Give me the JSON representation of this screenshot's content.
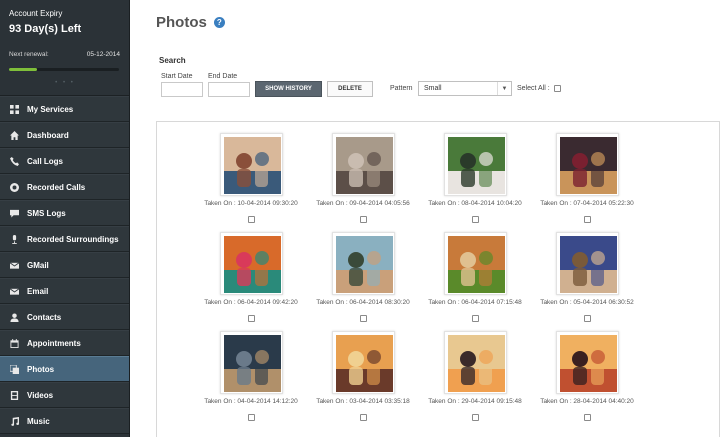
{
  "account": {
    "expiry_label": "Account Expiry",
    "days_left": "93 Day(s) Left",
    "renewal_label": "Next renewal:",
    "renewal_date": "05-12-2014",
    "progress_fraction": 0.25
  },
  "sidebar": {
    "items": [
      {
        "label": "My Services",
        "icon": "grid-icon"
      },
      {
        "label": "Dashboard",
        "icon": "dashboard-icon"
      },
      {
        "label": "Call Logs",
        "icon": "phone-icon"
      },
      {
        "label": "Recorded Calls",
        "icon": "record-icon"
      },
      {
        "label": "SMS Logs",
        "icon": "chat-icon"
      },
      {
        "label": "Recorded Surroundings",
        "icon": "microphone-icon"
      },
      {
        "label": "GMail",
        "icon": "mail-icon"
      },
      {
        "label": "Email",
        "icon": "mail-icon"
      },
      {
        "label": "Contacts",
        "icon": "person-icon"
      },
      {
        "label": "Appointments",
        "icon": "calendar-icon"
      },
      {
        "label": "Photos",
        "icon": "photos-icon",
        "active": true
      },
      {
        "label": "Videos",
        "icon": "film-icon"
      },
      {
        "label": "Music",
        "icon": "music-icon"
      }
    ]
  },
  "page": {
    "title": "Photos",
    "help_glyph": "?"
  },
  "search": {
    "heading": "Search",
    "start_date_label": "Start Date",
    "start_date_value": "",
    "end_date_label": "End Date",
    "end_date_value": "",
    "show_history_label": "SHOW HISTORY",
    "delete_label": "DELETE",
    "pattern_label": "Pattern",
    "pattern_value": "Small",
    "select_all_label": "Select All :"
  },
  "photos": [
    {
      "caption": "Taken On : 10-04-2014 09:30:20",
      "palette": [
        "#d9b89a",
        "#3a5a7a",
        "#8a4f3a"
      ]
    },
    {
      "caption": "Taken On : 09-04-2014 04:05:56",
      "palette": [
        "#a89a8a",
        "#5c4f48",
        "#c9bcb0"
      ]
    },
    {
      "caption": "Taken On : 08-04-2014 10:04:20",
      "palette": [
        "#4a7a3a",
        "#e8e4e0",
        "#2a3a2a"
      ]
    },
    {
      "caption": "Taken On : 07-04-2014 05:22:30",
      "palette": [
        "#3a2a30",
        "#c9945a",
        "#7a2030"
      ]
    },
    {
      "caption": "Taken On : 06-04-2014 09:42:20",
      "palette": [
        "#d86a2a",
        "#2a8a7a",
        "#d93a5a"
      ]
    },
    {
      "caption": "Taken On : 06-04-2014 08:30:20",
      "palette": [
        "#8ab0c0",
        "#c9a07a",
        "#3a4a3a"
      ]
    },
    {
      "caption": "Taken On : 06-04-2014 07:15:48",
      "palette": [
        "#c87a3a",
        "#5a8a2a",
        "#e0c090"
      ]
    },
    {
      "caption": "Taken On : 05-04-2014 06:30:52",
      "palette": [
        "#3a4a8a",
        "#d0b090",
        "#7a5a3a"
      ]
    },
    {
      "caption": "Taken On : 04-04-2014 14:12:20",
      "palette": [
        "#2a3a4a",
        "#b0906a",
        "#6a7a8a"
      ]
    },
    {
      "caption": "Taken On : 03-04-2014 03:35:18",
      "palette": [
        "#e8a050",
        "#6a3a2a",
        "#f0d090"
      ]
    },
    {
      "caption": "Taken On : 29-04-2014 09:15:48",
      "palette": [
        "#e8c890",
        "#f0a050",
        "#3a2a2a"
      ]
    },
    {
      "caption": "Taken On : 28-04-2014 04:40:20",
      "palette": [
        "#f0b060",
        "#c05030",
        "#3a2020"
      ]
    }
  ]
}
